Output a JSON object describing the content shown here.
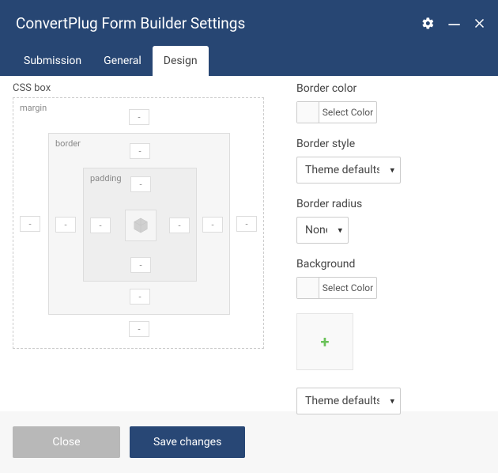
{
  "header": {
    "title": "ConvertPlug Form Builder Settings"
  },
  "tabs": {
    "t0": "Submission",
    "t1": "General",
    "t2": "Design"
  },
  "css": {
    "label": "CSS box",
    "margin": "margin",
    "border": "border",
    "padding": "padding",
    "dash": "-"
  },
  "fields": {
    "borderColor": {
      "label": "Border color",
      "btn": "Select Color"
    },
    "borderStyle": {
      "label": "Border style",
      "value": "Theme defaults"
    },
    "borderRadius": {
      "label": "Border radius",
      "value": "None"
    },
    "background": {
      "label": "Background",
      "btn": "Select Color"
    },
    "extra": {
      "value": "Theme defaults"
    }
  },
  "footer": {
    "close": "Close",
    "save": "Save changes"
  }
}
